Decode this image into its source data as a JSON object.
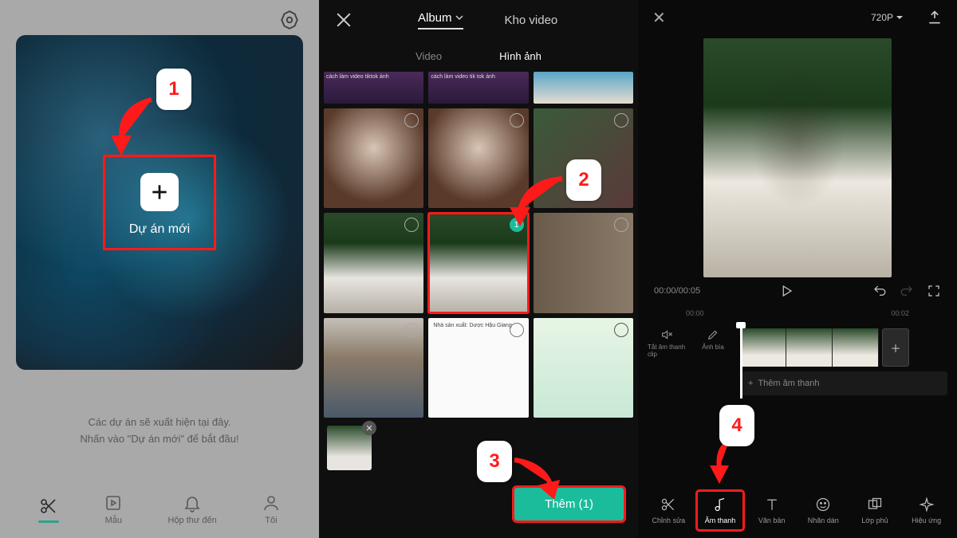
{
  "panel1": {
    "new_project_label": "Dự án mới",
    "caption_line1": "Các dự án sẽ xuất hiện tại đây.",
    "caption_line2": "Nhấn vào \"Dự án mới\" để bắt đầu!",
    "tabs": {
      "edit": "",
      "templates": "Mẫu",
      "inbox": "Hộp thư đến",
      "me": "Tôi"
    }
  },
  "panel2": {
    "tab_album": "Album",
    "tab_stock": "Kho video",
    "subtab_video": "Video",
    "subtab_image": "Hình ảnh",
    "selected_badge": "1",
    "add_button": "Thêm (1)",
    "doc_text": "Nhà sản xuất: Dược Hậu Giang"
  },
  "panel3": {
    "resolution": "720P",
    "time_current": "00:00",
    "time_total": "00:05",
    "ruler_a": "00:00",
    "ruler_b": "00:02",
    "mute_label": "Tắt âm thanh clip",
    "cover_label": "Ảnh bìa",
    "add_audio": "Thêm âm thanh",
    "tools": {
      "edit": "Chỉnh sửa",
      "audio": "Âm thanh",
      "text": "Văn bản",
      "sticker": "Nhãn dán",
      "overlay": "Lớp phủ",
      "effect": "Hiệu ứng"
    }
  },
  "callouts": {
    "n1": "1",
    "n2": "2",
    "n3": "3",
    "n4": "4"
  }
}
